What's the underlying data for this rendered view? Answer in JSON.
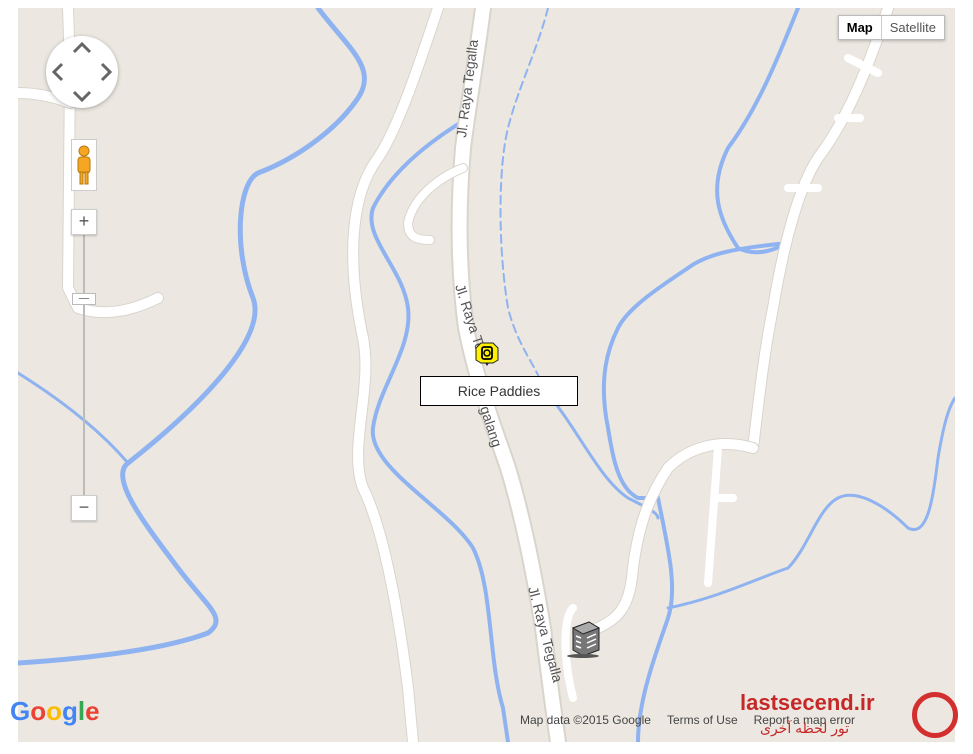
{
  "map_type": {
    "map_label": "Map",
    "satellite_label": "Satellite",
    "selected": "Map"
  },
  "controls": {
    "pan_icon": "pan-arrows-icon",
    "pegman_icon": "pegman-icon",
    "zoom_in_label": "+",
    "zoom_out_label": "−"
  },
  "roads": [
    {
      "name": "Jl. Raya Tegallalang",
      "label": "Jl. Raya Tegalla"
    },
    {
      "name": "Jl. Raya Tegallalang",
      "label": "Jl. Raya Te"
    },
    {
      "name": "Jl. Raya Tegallalang",
      "label": "galang"
    },
    {
      "name": "Jl. Raya Tegallalang",
      "label": "Jl. Raya Tegalla"
    }
  ],
  "place": {
    "label": "Rice Paddies",
    "icon": "camera-icon",
    "marker_color": "#fff200"
  },
  "building_icon": "hotel-building-icon",
  "attribution": {
    "logo": "Google",
    "map_data": "Map data ©2015 Google",
    "terms": "Terms of Use",
    "report": "Report a map error"
  },
  "watermark": {
    "text": "lastsecend.ir",
    "subtext": "تور لحظه آخری"
  },
  "colors": {
    "land": "#ece8e1",
    "water": "#8fb3f0",
    "road": "#ffffff",
    "label_box_border": "#000000"
  }
}
